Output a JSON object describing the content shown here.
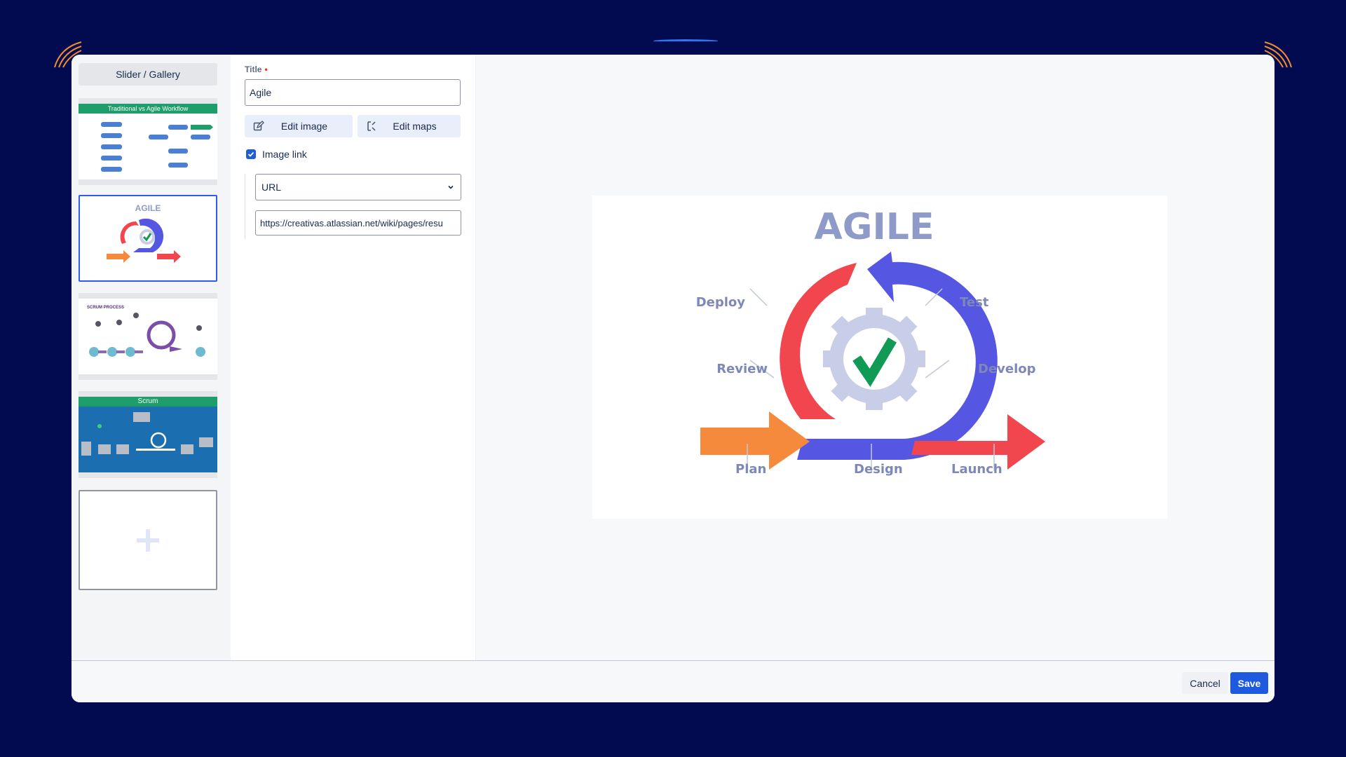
{
  "sidebar": {
    "title": "Slider / Gallery",
    "thumbnails": [
      {
        "caption": "Traditional vs Agile Workflow"
      },
      {
        "caption": "AGILE"
      },
      {
        "caption": "SCRUM PROCESS"
      },
      {
        "caption": "Scrum"
      }
    ]
  },
  "form": {
    "title_label": "Title",
    "required_mark": "•",
    "title_value": "Agile",
    "edit_image_label": "Edit image",
    "edit_maps_label": "Edit maps",
    "image_link_label": "Image link",
    "image_link_checked": true,
    "link_type_value": "URL",
    "url_value": "https://creativas.atlassian.net/wiki/pages/resu"
  },
  "preview": {
    "image_title": "AGILE",
    "stages": [
      "Deploy",
      "Test",
      "Review",
      "Develop",
      "Plan",
      "Design",
      "Launch"
    ]
  },
  "footer": {
    "cancel_label": "Cancel",
    "save_label": "Save"
  },
  "colors": {
    "background": "#020b50",
    "accent": "#1e5ae0",
    "agile_red": "#f2464f",
    "agile_blue": "#5557e3",
    "agile_orange": "#f68a3c",
    "agile_green": "#119a55"
  }
}
